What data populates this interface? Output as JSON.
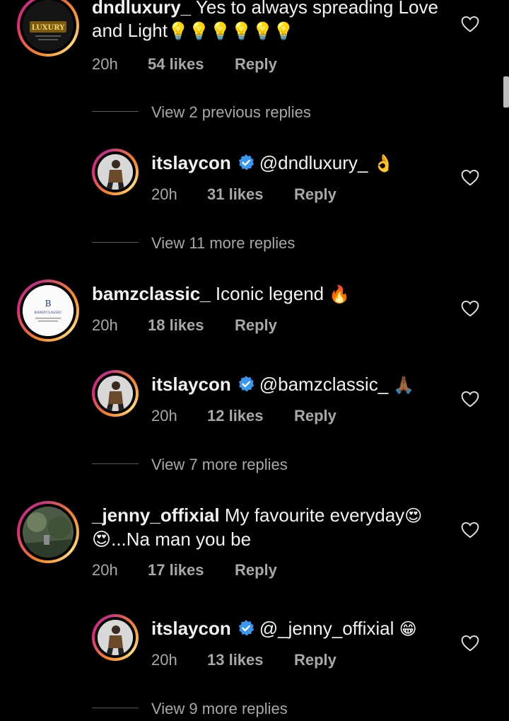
{
  "comments": [
    {
      "user": "dndluxury_",
      "text": "Yes to always spreading Love and Light",
      "emojis": "💡💡💡💡💡💡",
      "time": "20h",
      "likes": "54 likes",
      "reply": "Reply",
      "avatar_label": "LUXURY"
    },
    {
      "user": "itslaycon",
      "mention": "@dndluxury_",
      "emojis": "👌",
      "time": "20h",
      "likes": "31 likes",
      "reply": "Reply"
    },
    {
      "user": "bamzclassic_",
      "text": "Iconic legend",
      "emojis": "🔥",
      "time": "20h",
      "likes": "18 likes",
      "reply": "Reply",
      "avatar_label": "BAMZCLASSIC"
    },
    {
      "user": "itslaycon",
      "mention": "@bamzclassic_",
      "emojis": "🙏🏾",
      "time": "20h",
      "likes": "12 likes",
      "reply": "Reply"
    },
    {
      "user": "_jenny_offixial",
      "text": "My favourite everyday",
      "emojis": "😍",
      "text2": "😍...Na man you be",
      "time": "20h",
      "likes": "17 likes",
      "reply": "Reply"
    },
    {
      "user": "itslaycon",
      "mention": "@_jenny_offixial",
      "emojis": "😁",
      "time": "20h",
      "likes": "13 likes",
      "reply": "Reply"
    }
  ],
  "view_replies": [
    "View 2 previous replies",
    "View 11 more replies",
    "View 7 more replies",
    "View 9 more replies"
  ],
  "colors": {
    "background": "#000000",
    "text": "#f2f2f2",
    "muted": "#a8a8a8",
    "verified": "#3897f0"
  }
}
